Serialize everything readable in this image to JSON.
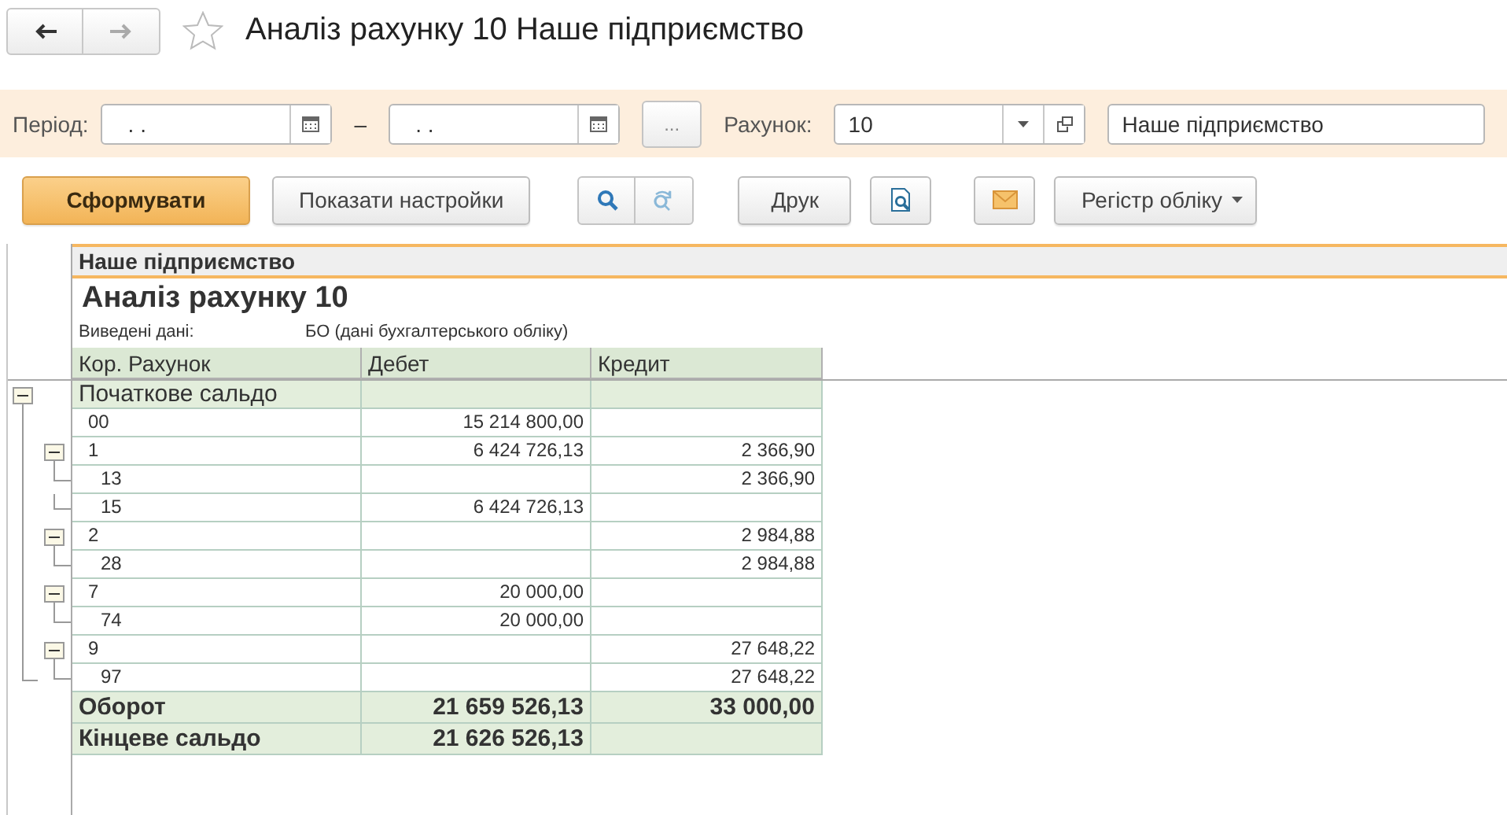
{
  "window": {
    "title": "Аналіз рахунку 10 Наше підприємство",
    "favorite": false
  },
  "filters": {
    "period_label": "Період:",
    "period_from": ". .",
    "period_separator": "–",
    "period_to": ". .",
    "period_more": "...",
    "account_label": "Рахунок:",
    "account": "10",
    "organization": "Наше підприємство"
  },
  "toolbar": [
    {
      "kind": "primary",
      "label": "Сформувати"
    },
    {
      "kind": "text",
      "label": "Показати настройки"
    },
    {
      "kind": "search"
    },
    {
      "kind": "text",
      "label": "Друк"
    },
    {
      "kind": "preview"
    },
    {
      "kind": "mail"
    },
    {
      "kind": "menu",
      "label": "Регістр обліку"
    }
  ],
  "report": {
    "organization": "Наше підприємство",
    "title": "Аналіз рахунку 10",
    "parameter_label": "Виведені дані:",
    "parameter_value": "БО (дані бухгалтерського обліку)",
    "columns": [
      "Кор. Рахунок",
      "Дебет",
      "Кредит"
    ],
    "rows": [
      {
        "account": "Початкове сальдо",
        "kind": "group",
        "expanded": true,
        "children": [
          {
            "account": "00",
            "debit": "15 214 800,00"
          },
          {
            "account": "1",
            "debit": "6 424 726,13",
            "credit": "2 366,90",
            "expanded": true,
            "children": [
              {
                "account": "13",
                "credit": "2 366,90"
              },
              {
                "account": "15",
                "debit": "6 424 726,13"
              }
            ]
          },
          {
            "account": "2",
            "credit": "2 984,88",
            "expanded": true,
            "children": [
              {
                "account": "28",
                "credit": "2 984,88"
              }
            ]
          },
          {
            "account": "7",
            "debit": "20 000,00",
            "expanded": true,
            "children": [
              {
                "account": "74",
                "debit": "20 000,00"
              }
            ]
          },
          {
            "account": "9",
            "credit": "27 648,22",
            "expanded": true,
            "children": [
              {
                "account": "97",
                "credit": "27 648,22"
              }
            ]
          }
        ]
      }
    ],
    "totals": [
      {
        "account": "Оборот",
        "debit": "21 659 526,13",
        "credit": "33 000,00"
      },
      {
        "account": "Кінцеве сальдо",
        "debit": "21 626 526,13"
      }
    ]
  }
}
